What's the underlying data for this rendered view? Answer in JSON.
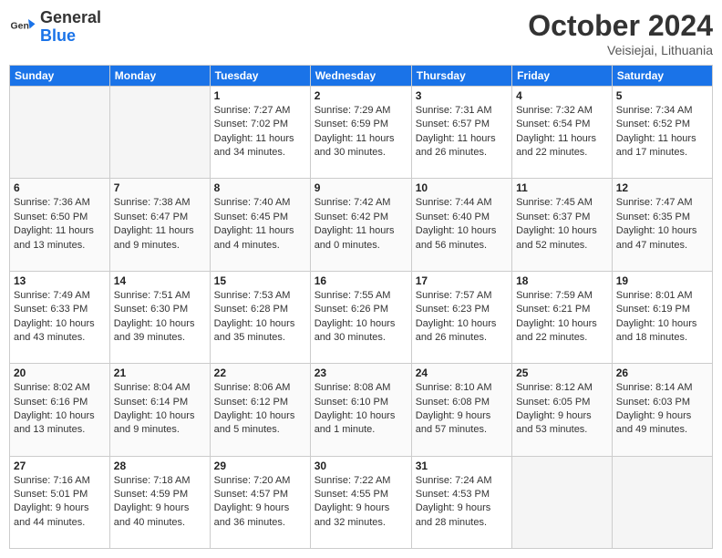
{
  "header": {
    "logo_general": "General",
    "logo_blue": "Blue",
    "month": "October 2024",
    "location": "Veisiejai, Lithuania"
  },
  "weekdays": [
    "Sunday",
    "Monday",
    "Tuesday",
    "Wednesday",
    "Thursday",
    "Friday",
    "Saturday"
  ],
  "weeks": [
    [
      {
        "day": "",
        "empty": true
      },
      {
        "day": "",
        "empty": true
      },
      {
        "day": "1",
        "sunrise": "7:27 AM",
        "sunset": "7:02 PM",
        "daylight": "11 hours and 34 minutes."
      },
      {
        "day": "2",
        "sunrise": "7:29 AM",
        "sunset": "6:59 PM",
        "daylight": "11 hours and 30 minutes."
      },
      {
        "day": "3",
        "sunrise": "7:31 AM",
        "sunset": "6:57 PM",
        "daylight": "11 hours and 26 minutes."
      },
      {
        "day": "4",
        "sunrise": "7:32 AM",
        "sunset": "6:54 PM",
        "daylight": "11 hours and 22 minutes."
      },
      {
        "day": "5",
        "sunrise": "7:34 AM",
        "sunset": "6:52 PM",
        "daylight": "11 hours and 17 minutes."
      }
    ],
    [
      {
        "day": "6",
        "sunrise": "7:36 AM",
        "sunset": "6:50 PM",
        "daylight": "11 hours and 13 minutes."
      },
      {
        "day": "7",
        "sunrise": "7:38 AM",
        "sunset": "6:47 PM",
        "daylight": "11 hours and 9 minutes."
      },
      {
        "day": "8",
        "sunrise": "7:40 AM",
        "sunset": "6:45 PM",
        "daylight": "11 hours and 4 minutes."
      },
      {
        "day": "9",
        "sunrise": "7:42 AM",
        "sunset": "6:42 PM",
        "daylight": "11 hours and 0 minutes."
      },
      {
        "day": "10",
        "sunrise": "7:44 AM",
        "sunset": "6:40 PM",
        "daylight": "10 hours and 56 minutes."
      },
      {
        "day": "11",
        "sunrise": "7:45 AM",
        "sunset": "6:37 PM",
        "daylight": "10 hours and 52 minutes."
      },
      {
        "day": "12",
        "sunrise": "7:47 AM",
        "sunset": "6:35 PM",
        "daylight": "10 hours and 47 minutes."
      }
    ],
    [
      {
        "day": "13",
        "sunrise": "7:49 AM",
        "sunset": "6:33 PM",
        "daylight": "10 hours and 43 minutes."
      },
      {
        "day": "14",
        "sunrise": "7:51 AM",
        "sunset": "6:30 PM",
        "daylight": "10 hours and 39 minutes."
      },
      {
        "day": "15",
        "sunrise": "7:53 AM",
        "sunset": "6:28 PM",
        "daylight": "10 hours and 35 minutes."
      },
      {
        "day": "16",
        "sunrise": "7:55 AM",
        "sunset": "6:26 PM",
        "daylight": "10 hours and 30 minutes."
      },
      {
        "day": "17",
        "sunrise": "7:57 AM",
        "sunset": "6:23 PM",
        "daylight": "10 hours and 26 minutes."
      },
      {
        "day": "18",
        "sunrise": "7:59 AM",
        "sunset": "6:21 PM",
        "daylight": "10 hours and 22 minutes."
      },
      {
        "day": "19",
        "sunrise": "8:01 AM",
        "sunset": "6:19 PM",
        "daylight": "10 hours and 18 minutes."
      }
    ],
    [
      {
        "day": "20",
        "sunrise": "8:02 AM",
        "sunset": "6:16 PM",
        "daylight": "10 hours and 13 minutes."
      },
      {
        "day": "21",
        "sunrise": "8:04 AM",
        "sunset": "6:14 PM",
        "daylight": "10 hours and 9 minutes."
      },
      {
        "day": "22",
        "sunrise": "8:06 AM",
        "sunset": "6:12 PM",
        "daylight": "10 hours and 5 minutes."
      },
      {
        "day": "23",
        "sunrise": "8:08 AM",
        "sunset": "6:10 PM",
        "daylight": "10 hours and 1 minute."
      },
      {
        "day": "24",
        "sunrise": "8:10 AM",
        "sunset": "6:08 PM",
        "daylight": "9 hours and 57 minutes."
      },
      {
        "day": "25",
        "sunrise": "8:12 AM",
        "sunset": "6:05 PM",
        "daylight": "9 hours and 53 minutes."
      },
      {
        "day": "26",
        "sunrise": "8:14 AM",
        "sunset": "6:03 PM",
        "daylight": "9 hours and 49 minutes."
      }
    ],
    [
      {
        "day": "27",
        "sunrise": "7:16 AM",
        "sunset": "5:01 PM",
        "daylight": "9 hours and 44 minutes."
      },
      {
        "day": "28",
        "sunrise": "7:18 AM",
        "sunset": "4:59 PM",
        "daylight": "9 hours and 40 minutes."
      },
      {
        "day": "29",
        "sunrise": "7:20 AM",
        "sunset": "4:57 PM",
        "daylight": "9 hours and 36 minutes."
      },
      {
        "day": "30",
        "sunrise": "7:22 AM",
        "sunset": "4:55 PM",
        "daylight": "9 hours and 32 minutes."
      },
      {
        "day": "31",
        "sunrise": "7:24 AM",
        "sunset": "4:53 PM",
        "daylight": "9 hours and 28 minutes."
      },
      {
        "day": "",
        "empty": true
      },
      {
        "day": "",
        "empty": true
      }
    ]
  ]
}
